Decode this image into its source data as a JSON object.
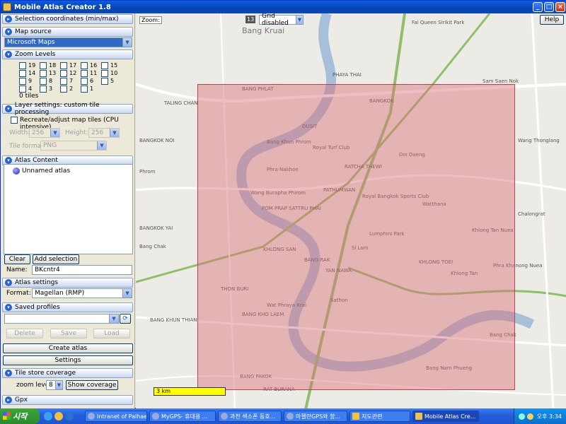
{
  "window": {
    "title": "Mobile Atlas Creator 1.8",
    "help_label": "Help"
  },
  "sections": {
    "selection": "Selection coordinates (min/max)",
    "map_source": "Map source",
    "zoom_levels": "Zoom Levels",
    "layer_settings": "Layer settings: custom tile processing",
    "atlas_content": "Atlas Content",
    "atlas_settings": "Atlas settings",
    "saved_profiles": "Saved profiles",
    "tile_store": "Tile store coverage",
    "gpx": "Gpx"
  },
  "map_source": {
    "value": "Microsoft Maps"
  },
  "zoom_levels": {
    "rows": [
      [
        "19",
        "18",
        "17",
        "16",
        "15"
      ],
      [
        "14",
        "13",
        "12",
        "11",
        "10"
      ],
      [
        "9",
        "8",
        "7",
        "6",
        "5"
      ],
      [
        "4",
        "3",
        "2",
        "1",
        ""
      ]
    ],
    "tiles": "0 tiles"
  },
  "layer_settings": {
    "recreate": "Recreate/adjust map tiles (CPU intensive)",
    "width_label": "Width:",
    "width_value": "256",
    "height_label": "Height:",
    "height_value": "256",
    "format_label": "Tile format:",
    "format_value": "PNG"
  },
  "atlas_content": {
    "item": "Unnamed atlas",
    "clear": "Clear",
    "add": "Add selection",
    "name_label": "Name:",
    "name_value": "BKcntr4"
  },
  "atlas_settings": {
    "format_label": "Format:",
    "format_value": "Magellan (RMP)"
  },
  "profiles": {
    "delete": "Delete",
    "save": "Save",
    "load": "Load"
  },
  "buttons": {
    "create": "Create atlas",
    "settings": "Settings"
  },
  "tile_store": {
    "zoom_label": "zoom level",
    "zoom_value": "8",
    "show": "Show coverage"
  },
  "map": {
    "zoom_label": "Zoom:",
    "zoom_value": "13",
    "grid_value": "Grid disabled",
    "scale": "3 km",
    "labels": [
      "Bang Kruai",
      "PHAYA THAI",
      "BANG PHLAT",
      "TALING CHAN",
      "DUSIT",
      "Bang Khun Phrom",
      "Royal Turf Club",
      "RATCHA THEWI",
      "Din Daeng",
      "Phra Nakhon",
      "BANGKOK NOI",
      "Wang Burapha Phirom",
      "PATHUMWAN",
      "Royal Bangkok Sports Club",
      "Watthana",
      "POM PRAP SATTRU PHAI",
      "BANGKOK YAI",
      "Lumphini Park",
      "KHLONG SAN",
      "Si Lom",
      "Khlong Tan Nuea",
      "BANG RAK",
      "KHLONG TOEI",
      "YAN NAWA",
      "Khlong Tan",
      "THON BURI",
      "Phra Khanong Nuea",
      "Wat Phraya Krai",
      "Sathon",
      "BANG KHO LAEM",
      "BANG KHUN THIAN",
      "Bang Chak",
      "Bang Nam Phueng",
      "BANG PAKOK",
      "RAT BURANA",
      "Bang Chak",
      "Sam Saen Nok",
      "Wang Thonglang",
      "Fai Queen Sirikit Park",
      "Chalongrat",
      "BANGKOK",
      "Phrom"
    ]
  },
  "taskbar": {
    "start": "시작",
    "items": [
      "Intranet of Palhae...",
      "MyGPS- 휴대용 ...",
      "과천 색소폰 동호...",
      "마젤란GPS와 함...",
      "지도관련",
      "Mobile Atlas Cre..."
    ],
    "clock": "오후 3:34"
  }
}
